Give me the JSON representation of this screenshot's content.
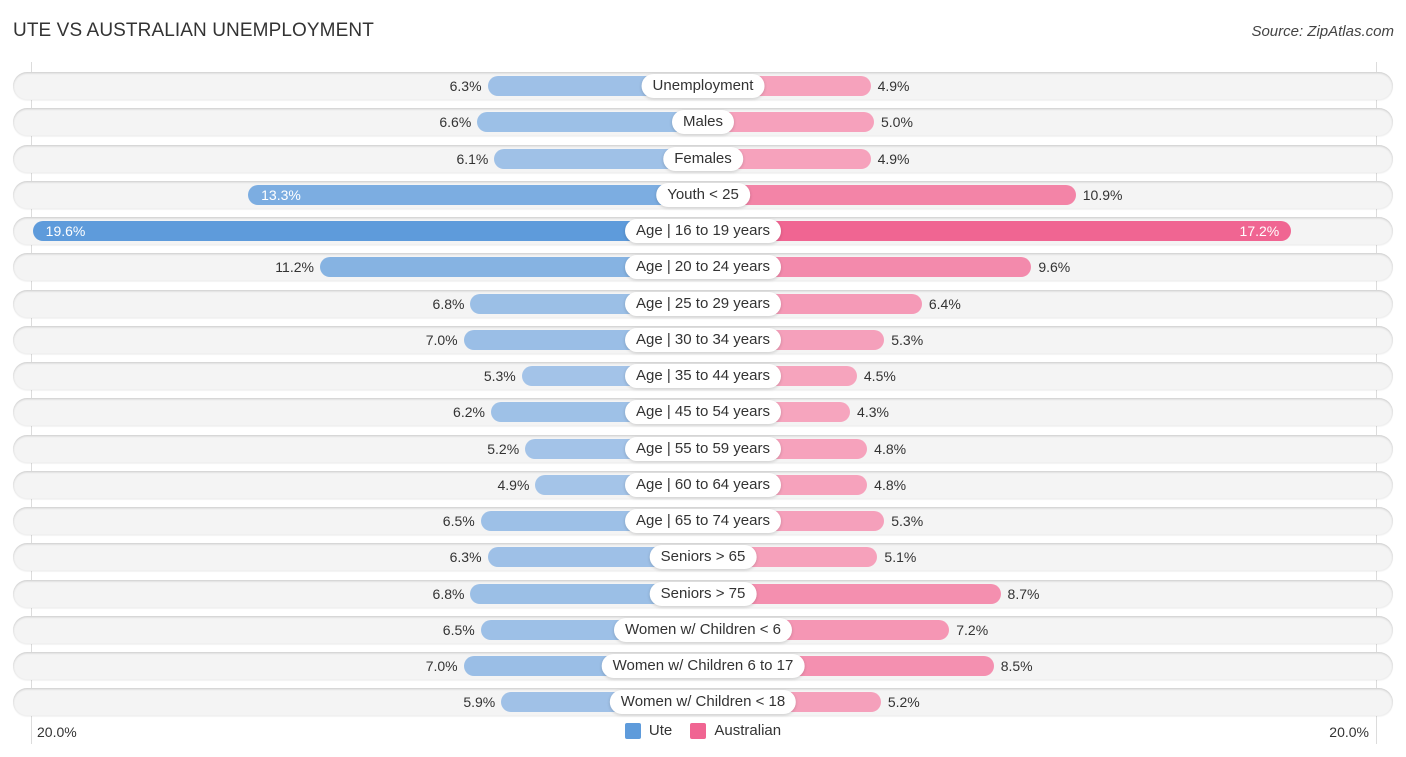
{
  "title": "UTE VS AUSTRALIAN UNEMPLOYMENT",
  "source": "Source: ZipAtlas.com",
  "colors": {
    "ute_light": "#a4c4e8",
    "ute_strong": "#5e9bdb",
    "australian_light": "#f6a6bf",
    "australian_strong": "#f06592"
  },
  "chart_data": {
    "type": "bar",
    "orientation": "diverging-horizontal",
    "title": "UTE VS AUSTRALIAN UNEMPLOYMENT",
    "xlabel": "",
    "ylabel": "",
    "xlim": [
      -20.0,
      20.0
    ],
    "axis_tick_labels": {
      "left": "20.0%",
      "right": "20.0%"
    },
    "legend": {
      "position": "bottom-center",
      "entries": [
        "Ute",
        "Australian"
      ]
    },
    "categories": [
      "Unemployment",
      "Males",
      "Females",
      "Youth < 25",
      "Age | 16 to 19 years",
      "Age | 20 to 24 years",
      "Age | 25 to 29 years",
      "Age | 30 to 34 years",
      "Age | 35 to 44 years",
      "Age | 45 to 54 years",
      "Age | 55 to 59 years",
      "Age | 60 to 64 years",
      "Age | 65 to 74 years",
      "Seniors > 65",
      "Seniors > 75",
      "Women w/ Children < 6",
      "Women w/ Children 6 to 17",
      "Women w/ Children < 18"
    ],
    "series": [
      {
        "name": "Ute",
        "side": "left",
        "values": [
          6.3,
          6.6,
          6.1,
          13.3,
          19.6,
          11.2,
          6.8,
          7.0,
          5.3,
          6.2,
          5.2,
          4.9,
          6.5,
          6.3,
          6.8,
          6.5,
          7.0,
          5.9
        ],
        "labels": [
          "6.3%",
          "6.6%",
          "6.1%",
          "13.3%",
          "19.6%",
          "11.2%",
          "6.8%",
          "7.0%",
          "5.3%",
          "6.2%",
          "5.2%",
          "4.9%",
          "6.5%",
          "6.3%",
          "6.8%",
          "6.5%",
          "7.0%",
          "5.9%"
        ]
      },
      {
        "name": "Australian",
        "side": "right",
        "values": [
          4.9,
          5.0,
          4.9,
          10.9,
          17.2,
          9.6,
          6.4,
          5.3,
          4.5,
          4.3,
          4.8,
          4.8,
          5.3,
          5.1,
          8.7,
          7.2,
          8.5,
          5.2
        ],
        "labels": [
          "4.9%",
          "5.0%",
          "4.9%",
          "10.9%",
          "17.2%",
          "9.6%",
          "6.4%",
          "5.3%",
          "4.5%",
          "4.3%",
          "4.8%",
          "4.8%",
          "5.3%",
          "5.1%",
          "8.7%",
          "7.2%",
          "8.5%",
          "5.2%"
        ]
      }
    ]
  }
}
